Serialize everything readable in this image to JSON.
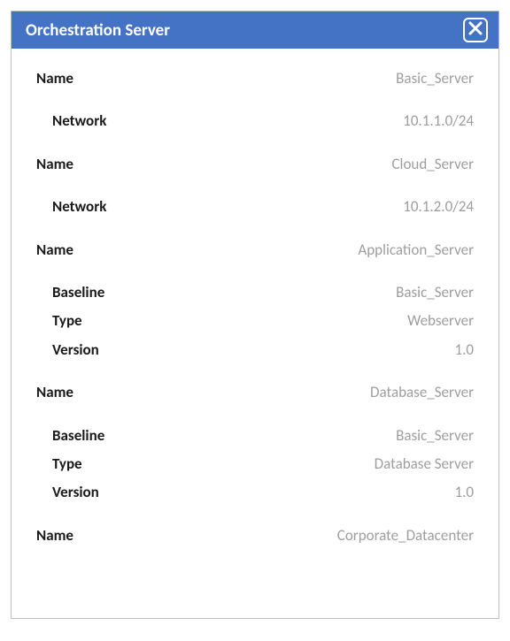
{
  "header": {
    "title": "Orchestration Server"
  },
  "labels": {
    "name": "Name",
    "network": "Network",
    "baseline": "Baseline",
    "type": "Type",
    "version": "Version"
  },
  "items": [
    {
      "name": "Basic_Server",
      "fields": [
        {
          "key": "network",
          "value": "10.1.1.0/24"
        }
      ]
    },
    {
      "name": "Cloud_Server",
      "fields": [
        {
          "key": "network",
          "value": "10.1.2.0/24"
        }
      ]
    },
    {
      "name": "Application_Server",
      "fields": [
        {
          "key": "baseline",
          "value": "Basic_Server"
        },
        {
          "key": "type",
          "value": "Webserver"
        },
        {
          "key": "version",
          "value": "1.0"
        }
      ]
    },
    {
      "name": "Database_Server",
      "fields": [
        {
          "key": "baseline",
          "value": "Basic_Server"
        },
        {
          "key": "type",
          "value": "Database Server"
        },
        {
          "key": "version",
          "value": "1.0"
        }
      ]
    },
    {
      "name": "Corporate_Datacenter",
      "fields": []
    }
  ]
}
